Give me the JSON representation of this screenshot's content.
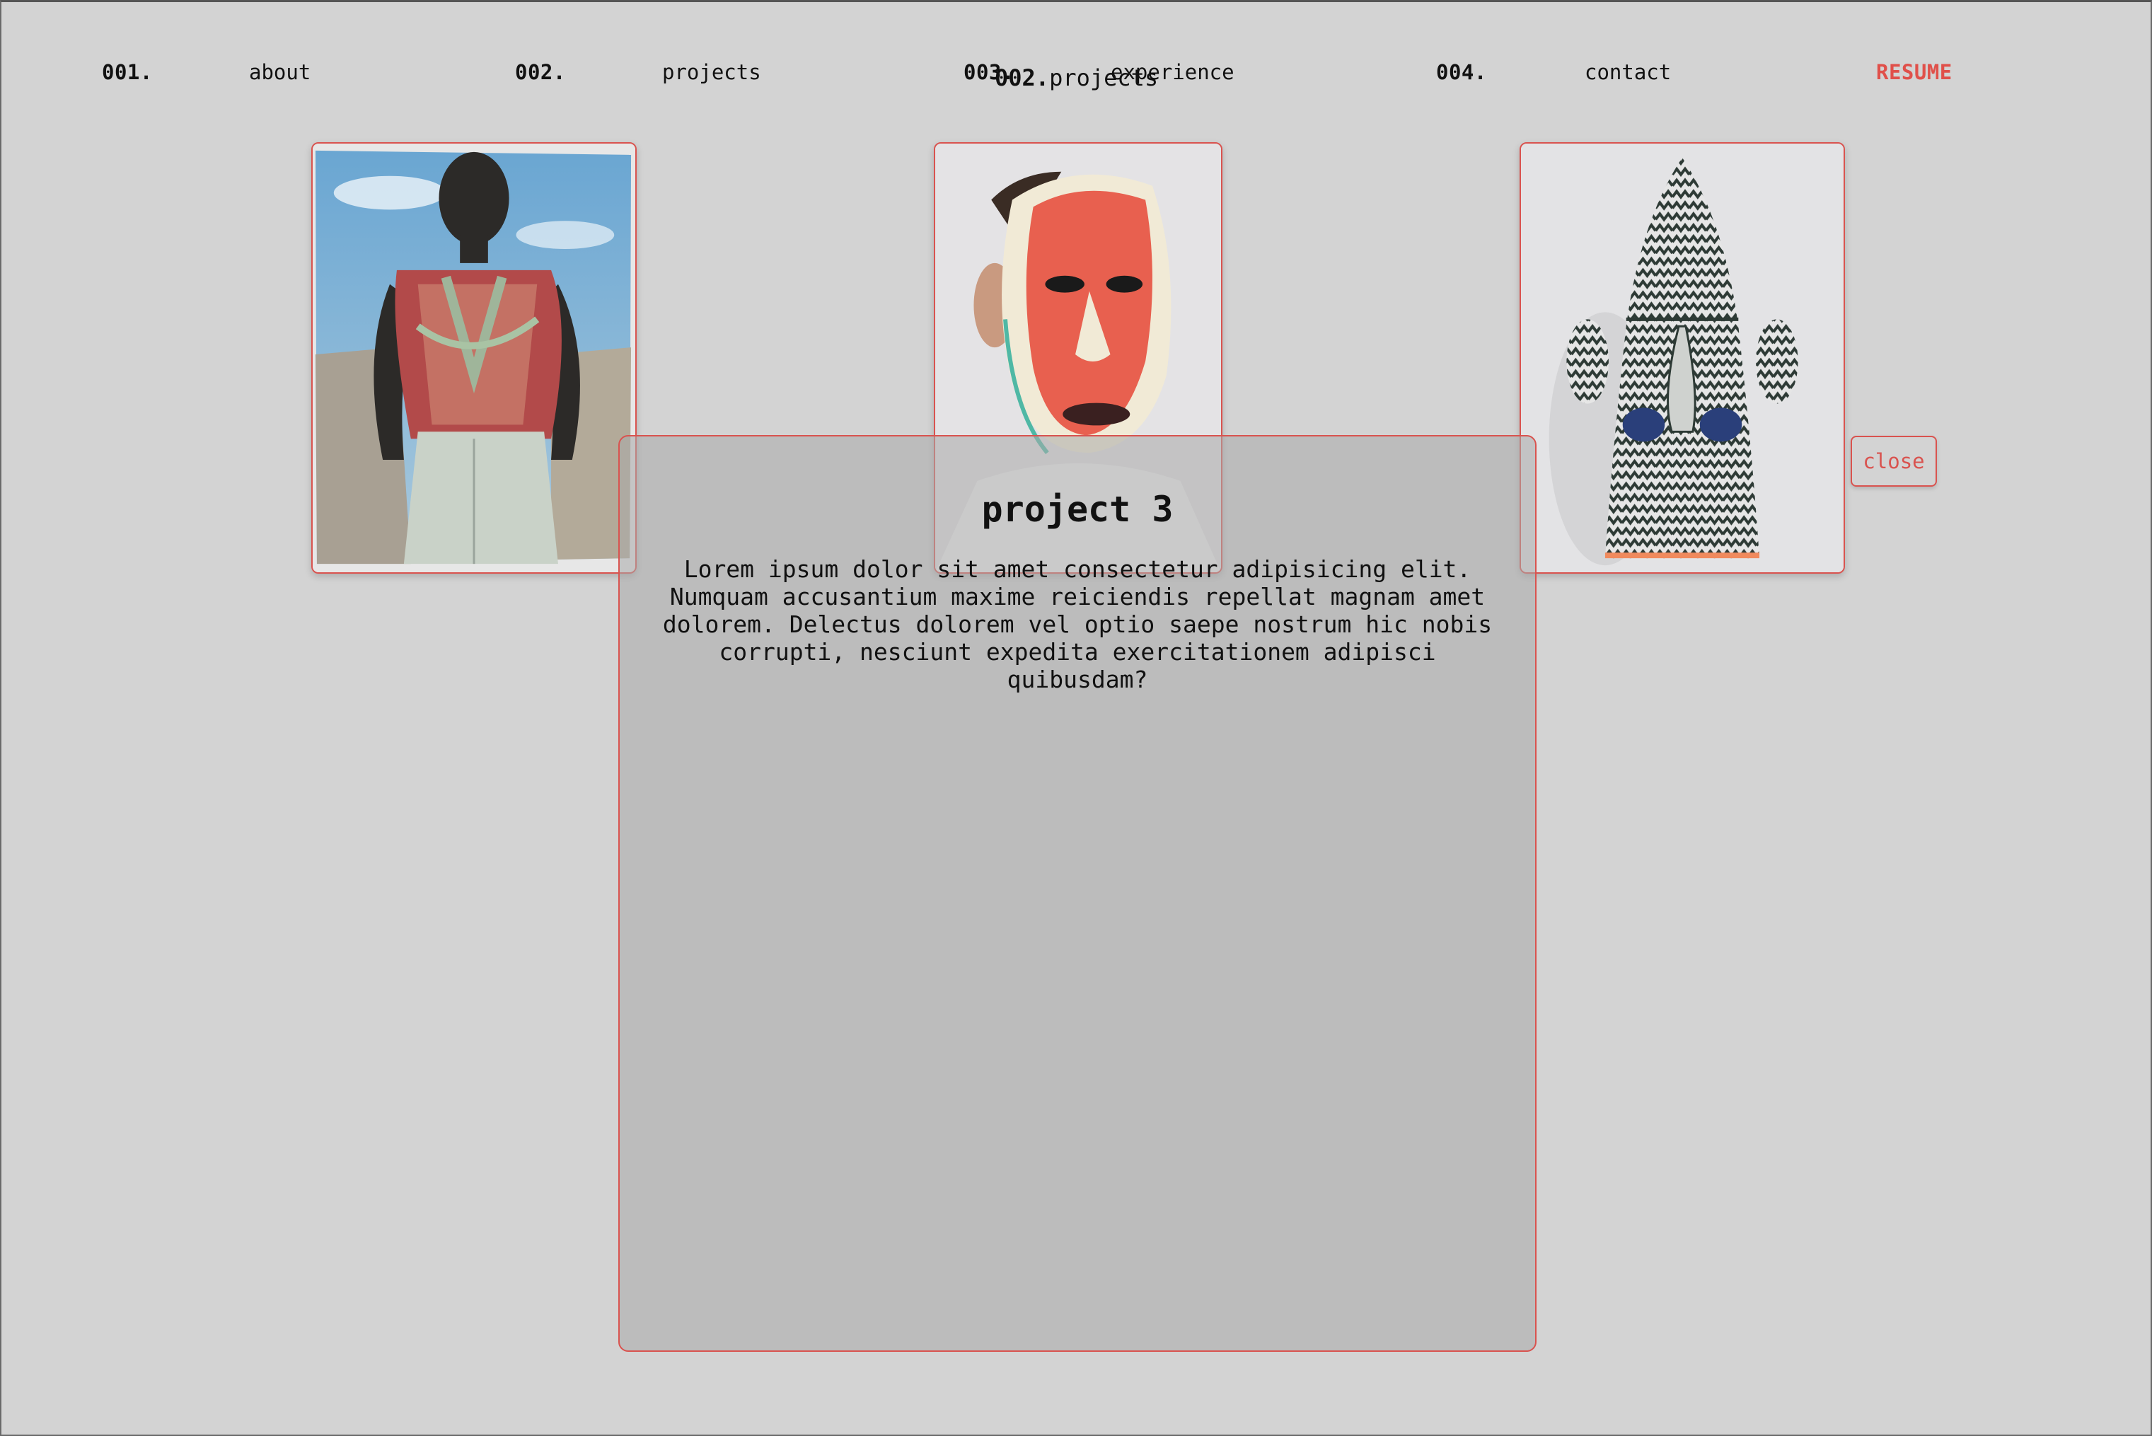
{
  "nav": {
    "items": [
      {
        "num": "001.",
        "label": "about"
      },
      {
        "num": "002.",
        "label": "projects"
      },
      {
        "num": "003.",
        "label": "experience"
      },
      {
        "num": "004.",
        "label": "contact"
      }
    ],
    "resume_label": "RESUME"
  },
  "section": {
    "num": "002.",
    "label": "projects"
  },
  "projects": [
    {
      "icon": "portrait-photo"
    },
    {
      "icon": "red-mask-sculpture-photo"
    },
    {
      "icon": "woven-head-sculpture-photo"
    }
  ],
  "modal": {
    "title": "project 3",
    "body_lines": [
      "Lorem ipsum dolor sit amet consectetur adipisicing elit.",
      "Numquam accusantium maxime reiciendis repellat magnam amet",
      "dolorem. Delectus dolorem vel optio saepe nostrum hic nobis",
      "corrupti, nesciunt expedita exercitationem adipisci quibusdam?"
    ],
    "close_label": "close"
  },
  "colors": {
    "accent": "#d9534f",
    "background": "#d3d3d3"
  }
}
